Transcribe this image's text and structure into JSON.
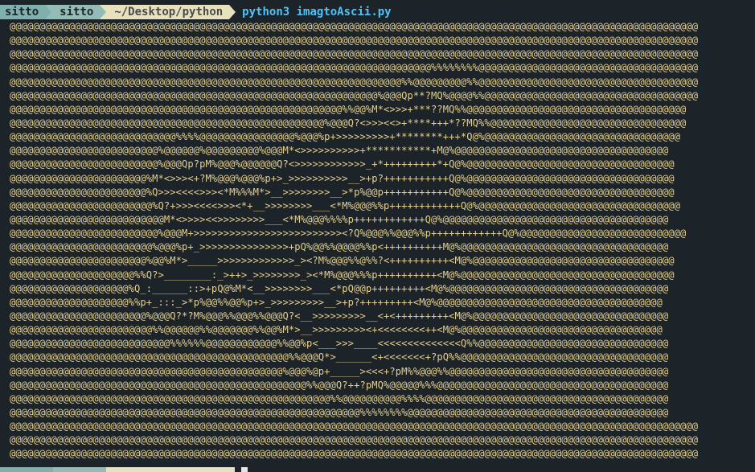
{
  "prompt": {
    "user": "sitto",
    "host": "sitto",
    "path": "~/Desktop/python",
    "command": "python3 imagtoAscii.py"
  },
  "colors": {
    "background": "#1c2329",
    "ascii_text": "#e4cf8e",
    "command": "#4fc3f7",
    "segment_user": "#7fb0ae",
    "segment_host": "#93bcb6",
    "segment_path": "#e8e1bd"
  },
  "ascii_art": [
    "@@@@@@@@@@@@@@@@@@@@@@@@@@@@@@@@@@@@@@@@@@@@@@@@@@@@@@@@@@@@@@@@@@@@@@@@@@@@@@@@@@@@@@@@@@@@@@@@@@@@@@@@@@@@@@@@@@@@",
    "@@@@@@@@@@@@@@@@@@@@@@@@@@@@@@@@@@@@@@@@@@@@@@@@@@@@@@@@@@@@@@@@@@@@@@@@@@@@@@@@@@@@@@@@@@@@@@@@@@@@@@@@@@@@@@@@@@@@",
    "@@@@@@@@@@@@@@@@@@@@@@@@@@@@@@@@@@@@@@@@@@@@@@@@@@@@@@@@@@@@@@@@@@@@@@@@@@@@@@@@@@@@@@@@@@@@@@@@@@@@@@@@@@@@@@@@@@@@",
    "@@@@@@@@@@@@@@@@@@@@@@@@@@@@@@@@@@@@@@@@@@@@@@@@@@@@@@@@@@@@@@@@@@@@@@@%%%%%%%%@@@@@@@@@@@@@@@@@@@@@@@@@@@@@@@@@@@@@",
    "@@@@@@@@@@@@@@@@@@@@@@@@@@@@@@@@@@@@@@@@@@@@@@@@@@@@@@@@@@@@@@@@@@%%@@@@@@@@@%%@@@@@@@@@@@@@@@@@@@@@@@@@@@@@@@@@@@@@",
    "@@@@@@@@@@@@@@@@@@@@@@@@@@@@@@@@@@@@@@@@@@@@@@@@@@@@@@@@@@@@@@%@@@Qp**?MQ%@@@@%%@@@@@@@@@@@@@@@@@@@@@@@@@@@@@@@@@@@@",
    "@@@@@@@@@@@@@@@@@@@@@@@@@@@@@@@@@@@@@@@@@@@@@@@@@@@@@@@@%%@@%M*<>>>+***??MQ%%@@@@@@@@@@@@@@@@@@@@@@@@@@@@@@@@@@@@@",
    "@@@@@@@@@@@@@@@@@@@@@@@@@@@@@@@@@@@@@@@@@@@@@@@@@@@@@%@@@Q?<>>><<>+****+++*??MQ%%@@@@@@@@@@@@@@@@@@@@@@@@@@@@@@@@@",
    "@@@@@@@@@@@@@@@@@@@@@@@@@@@@%%%%@@@@@@@@@@@@@@@@%@@@%p+>>>>>>>>>+********+++*Q@%@@@@@@@@@@@@@@@@@@@@@@@@@@@@@@@@@",
    "@@@@@@@@@@@@@@@@@@@@@@@@@%@@@@@@%@@@@@@@@@%@@@M*<>>>>>>>>>>+***********+M@%@@@@@@@@@@@@@@@@@@@@@@@@@@@@@@@@@@@@",
    "@@@@@@@@@@@@@@@@@@@@@@@@@%@@@Qp?pM%@@@%@@@@@@Q?<>>>>>>>>>>>>_+*+++++++++*+Q@%@@@@@@@@@@@@@@@@@@@@@@@@@@@@@@@@@@@",
    "@@@@@@@@@@@@@@@@@@@@@@@%M*<>>><+?M%@@@%@@@%p+>_>>>>>>>>>>__>+p?+++++++++++Q@%@@@@@@@@@@@@@@@@@@@@@@@@@@@@@@@@@@@",
    "@@@@@@@@@@@@@@@@@@@@@@@%Q>>><<<<>>><*M%%%M*>__>>>>>>>>__>*p%@@p+++++++++++Q@%@@@@@@@@@@@@@@@@@@@@@@@@@@@@@@@@@@@",
    "@@@@@@@@@@@@@@@@@@@@@@@@%Q?+>>><<<<>>><*+__>>>>>>>>___<*M%@@@%%p++++++++++++Q@%@@@@@@@@@@@@@@@@@@@@@@@@@@@@@@@@@@",
    "@@@@@@@@@@@@@@@@@@@@@@@@@@M*<>>>><<>>>>>>>>___<*M%@@@%%%%p++++++++++++Q@%@@@@@@@@@@@@@@@@@@@@@@@@@@@@@@@@@@@@@@",
    "@@@@@@@@@@@@@@@@@@@@@@@@@%@@@M+>>>>>>>>>>>>>>>>>>>>>>>>><?Q%@@@%%@@@%%p++++++++++++Q@%@@@@@@@@@@@@@@@@@@@@@@@@@@@@",
    "@@@@@@@@@@@@@@@@@@@@@@@@%@@@%p+_>>>>>>>>>>>>>>>+pQ%@@%%@@@@%%p<++++++++++M@%@@@@@@@@@@@@@@@@@@@@@@@@@@@@@@@@@@@",
    "@@@@@@@@@@@@@@@@@@@@@@@%@@%M*>_____>>>>>>>>>>>>>_><?M%@@@%%@%%?<++++++++++<M@%@@@@@@@@@@@@@@@@@@@@@@@@@@@@@@@@@@",
    "@@@@@@@@@@@@@@@@@@@@@%%Q?>________:_>++>_>>>>>>>>_><*M%@@@%%%p++++++++++<M@%@@@@@@@@@@@@@@@@@@@@@@@@@@@@@@@@@@@@",
    "@@@@@@@@@@@@@@@@@@@@%Q_:______::>+pQ@%M*<__>>>>>>>>___<*pQ@@p+++++++++<M@%@@@@@@@@@@@@@@@@@@@@@@@@@@@@@@@@@@@@@",
    "@@@@@@@@@@@@@@@@@@@@%%p+_:::_>*p%@@%%@@%p+>_>>>>>>>>>__>+p?+++++++++<M@%@@@@@@@@@@@@@@@@@@@@@@@@@@@@@@@@@@@@@@",
    "@@@@@@@@@@@@@@@@@@@@@@@%@@@Q?*?M%@@@%%@@@%%@@@Q?<__>>>>>>>>>__<+<+++++++++<M@%@@@@@@@@@@@@@@@@@@@@@@@@@@@@@@@@@",
    "@@@@@@@@@@@@@@@@@@@@@@@@%%@@@@@@%%@@@@@@@%%@@%M*>__>>>>>>>>><+<<<<<<<<++<M@%@@@@@@@@@@@@@@@@@@@@@@@@@@@@@@@@@@",
    "@@@@@@@@@@@@@@@@@@@@@@@@@@@%%%%%%@@@@@@@@@@@@%%@@%p<___>>>____<<<<<<<<<<<<<<Q%%@@@@@@@@@@@@@@@@@@@@@@@@@@@@@@@@",
    "@@@@@@@@@@@@@@@@@@@@@@@@@@@@@@@@@@@@@@@@@@@@@@@%%@@@Q*>______<+<<<<<<<+?pQ%%@@@@@@@@@@@@@@@@@@@@@@@@@@@@@@@@@@@",
    "@@@@@@@@@@@@@@@@@@@@@@@@@@@@@@@@@@@@@@@@@@@@@@%@@@%@p+_____><<<+?pM%%@@@%%@@@@@@@@@@@@@@@@@@@@@@@@@@@@@@@@@@@@@",
    "@@@@@@@@@@@@@@@@@@@@@@@@@@@@@@@@@@@@@@@@@@@@@@@@@@%%@@@Q?++?pMQ%@@@@@%%%@@@@@@@@@@@@@@@@@@@@@@@@@@@@@@@@@@@@@@@",
    "@@@@@@@@@@@@@@@@@@@@@@@@@@@@@@@@@@@@@@@@@@@@@@@@@@@@@@%%@@@@@@@@@@%%%%@@@@@@@@@@@@@@@@@@@@@@@@@@@@@@@@@@@@@@@@@",
    "@@@@@@@@@@@@@@@@@@@@@@@@@@@@@@@@@@@@@@@@@@@@@@@@@@@@@@@@@@@%%%%%%%%@@@@@@@@@@@@@@@@@@@@@@@@@@@@@@@@@@@@@@@@@@@@",
    "@@@@@@@@@@@@@@@@@@@@@@@@@@@@@@@@@@@@@@@@@@@@@@@@@@@@@@@@@@@@@@@@@@@@@@@@@@@@@@@@@@@@@@@@@@@@@@@@@@@@@@@@@@@@@@@@@@@@",
    "@@@@@@@@@@@@@@@@@@@@@@@@@@@@@@@@@@@@@@@@@@@@@@@@@@@@@@@@@@@@@@@@@@@@@@@@@@@@@@@@@@@@@@@@@@@@@@@@@@@@@@@@@@@@@@@@@@@@",
    "@@@@@@@@@@@@@@@@@@@@@@@@@@@@@@@@@@@@@@@@@@@@@@@@@@@@@@@@@@@@@@@@@@@@@@@@@@@@@@@@@@@@@@@@@@@@@@@@@@@@@@@@@@@@@@@@@@@@"
  ]
}
